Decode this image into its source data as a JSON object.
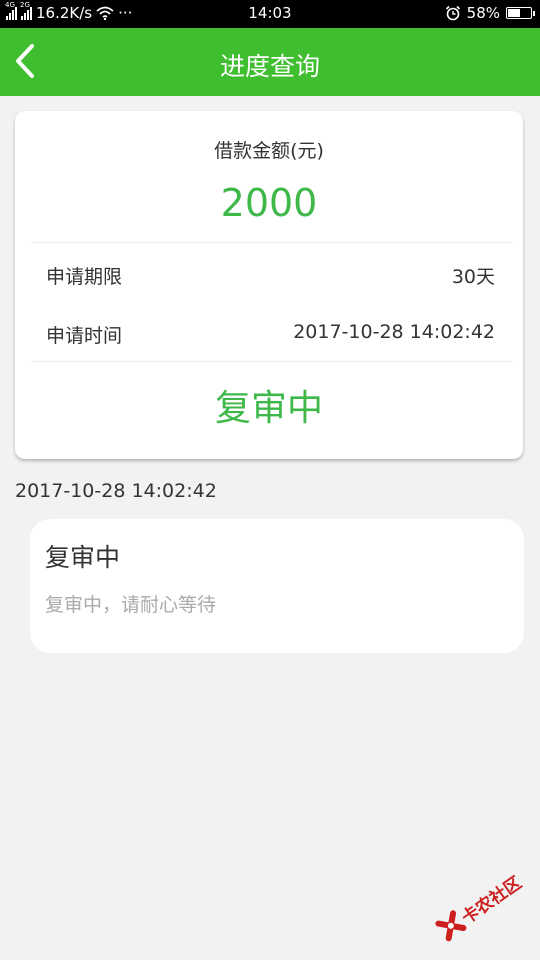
{
  "status_bar": {
    "network_1": "4G",
    "network_2": "2G",
    "speed": "16.2K/s",
    "more": "···",
    "time": "14:03",
    "battery": "58%",
    "battery_level": 0.58
  },
  "header": {
    "title": "进度查询"
  },
  "summary": {
    "amount_label": "借款金额(元)",
    "amount": "2000",
    "rows": [
      {
        "label": "申请期限",
        "value": "30天"
      },
      {
        "label": "申请时间",
        "value": "2017-10-28 14:02:42"
      }
    ],
    "status": "复审中"
  },
  "timeline": {
    "time": "2017-10-28 14:02:42",
    "title": "复审中",
    "description": "复审中，请耐心等待"
  },
  "watermark": {
    "text": "卡农社区"
  },
  "colors": {
    "accent": "#3fbe2f",
    "amount": "#3fb84a",
    "watermark": "#cc1f1f"
  }
}
